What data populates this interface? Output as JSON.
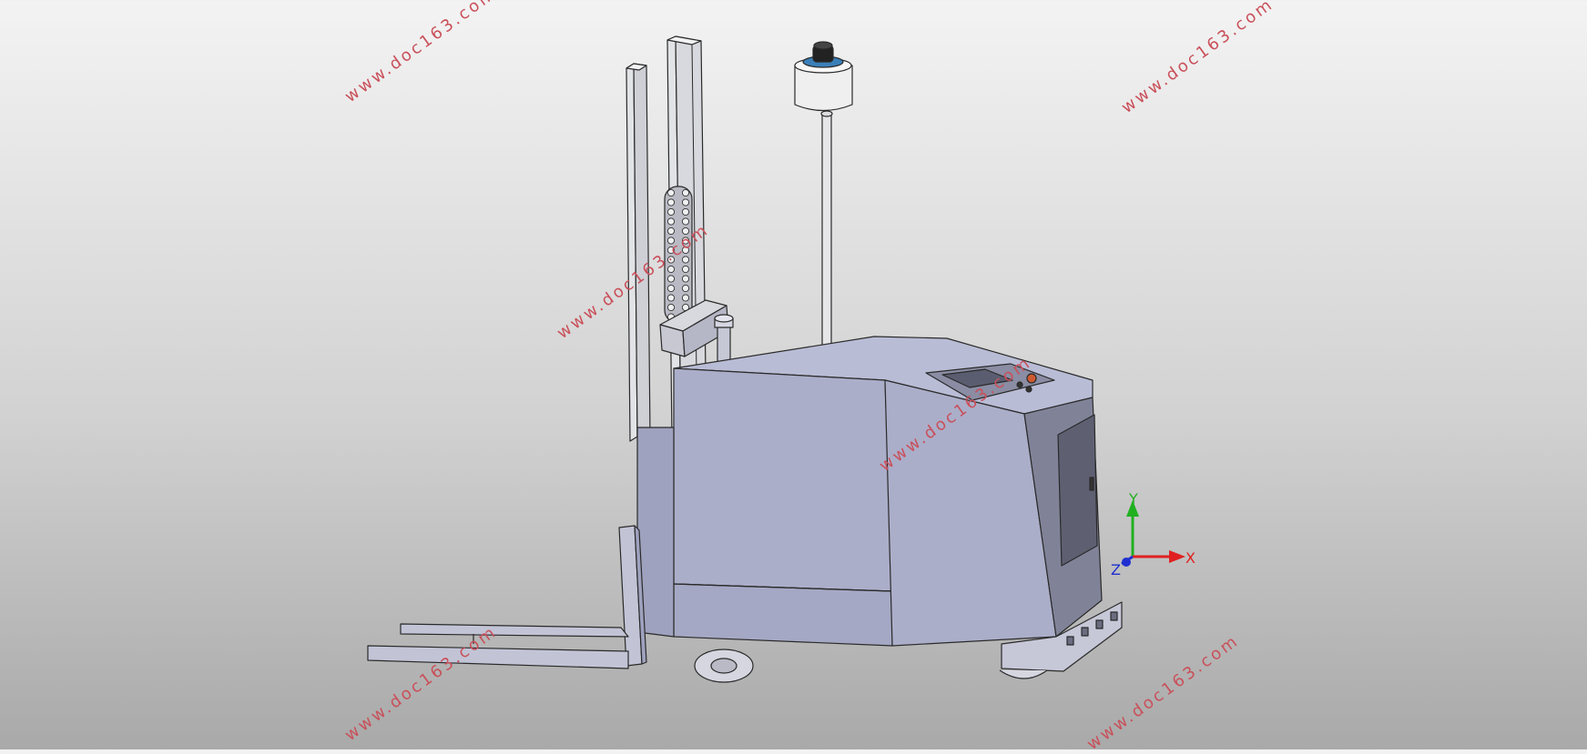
{
  "watermark_text": "www.doc163.com",
  "triad": {
    "x_label": "X",
    "y_label": "Y",
    "z_label": "Z"
  },
  "colors": {
    "body": "#abaec9",
    "body_dark": "#808398",
    "body_shade": "#9699b3",
    "mast": "#e2e3e6",
    "fork": "#c2c4d6",
    "outline": "#2a2a2a",
    "watermark": "#c9505a",
    "axis_x": "#e02020",
    "axis_y": "#20b020",
    "axis_z": "#2030d0",
    "sensor_blue": "#3a7fb8"
  }
}
